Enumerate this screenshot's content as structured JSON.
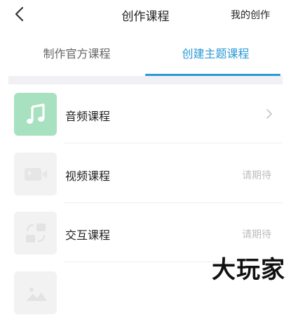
{
  "header": {
    "title": "创作课程",
    "right_action": "我的创作",
    "back_icon": "chevron-left-icon"
  },
  "tabs": [
    {
      "label": "制作官方课程",
      "active": false
    },
    {
      "label": "创建主题课程",
      "active": true
    }
  ],
  "colors": {
    "accent": "#2a9ad6",
    "audio_thumb": "#a7e1c0",
    "disabled_text": "#bdbdbd"
  },
  "courses": [
    {
      "label": "音频课程",
      "icon": "music-note-icon",
      "status": "",
      "enabled": true
    },
    {
      "label": "视频课程",
      "icon": "video-camera-icon",
      "status": "请期待",
      "enabled": false
    },
    {
      "label": "交互课程",
      "icon": "interactive-icon",
      "status": "请期待",
      "enabled": false
    },
    {
      "label": "",
      "icon": "image-icon",
      "status": "",
      "enabled": false
    }
  ],
  "watermark": "大玩家"
}
